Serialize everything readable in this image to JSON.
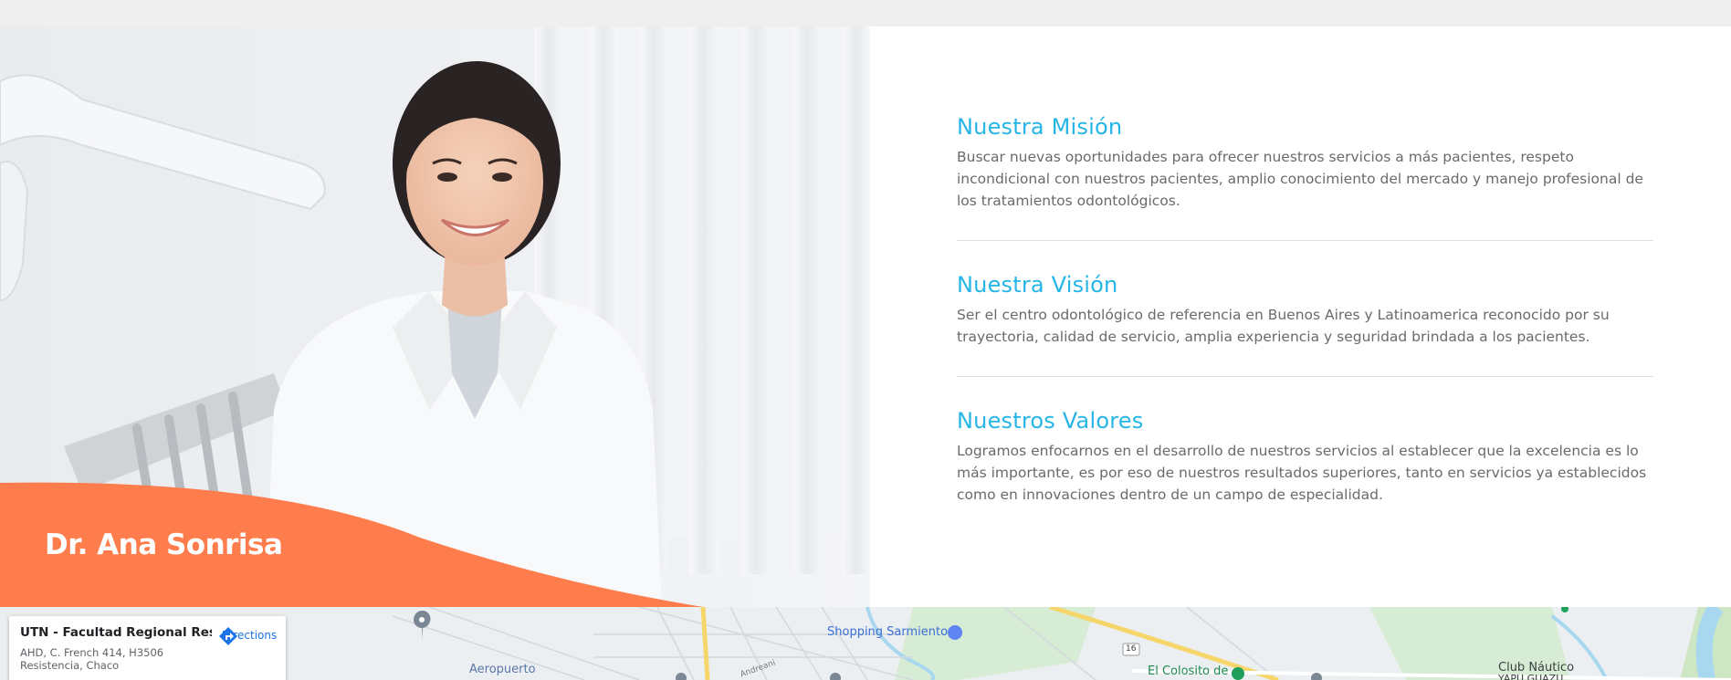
{
  "doctor": {
    "name": "Dr. Ana Sonrisa"
  },
  "sections": [
    {
      "title": "Nuestra Misión",
      "text": "Buscar nuevas oportunidades para ofrecer nuestros servicios a más pacientes, respeto incondicional con nuestros pacientes, amplio conocimiento del mercado y manejo profesional de los tratamientos odontológicos."
    },
    {
      "title": "Nuestra Visión",
      "text": "Ser el centro odontológico de referencia en Buenos Aires y Latinoamerica reconocido por su trayectoria, calidad de servicio, amplia experiencia y seguridad brindada a los pacientes."
    },
    {
      "title": "Nuestros Valores",
      "text": "Logramos enfocarnos en el desarrollo de nuestros servicios al establecer que la excelencia es lo más importante, es por eso de nuestros resultados superiores, tanto en servicios ya establecidos como en innovaciones dentro de un campo de especialidad."
    }
  ],
  "map": {
    "place_name": "UTN - Facultad Regional Resis...",
    "address_line1": "AHD, C. French 414, H3506",
    "address_line2": "Resistencia, Chaco",
    "directions_label": "Directions",
    "labels": {
      "shopping": "Shopping Sarmiento",
      "airport": "Aeropuerto",
      "colosito": "El Colosito de",
      "club": "Club Náutico",
      "club2": "YAPU GUAZU",
      "road": "16",
      "street": "Andreani"
    }
  },
  "colors": {
    "accent": "#25b5e6",
    "orange": "#ff7d4c",
    "text": "#6a6a6a"
  }
}
